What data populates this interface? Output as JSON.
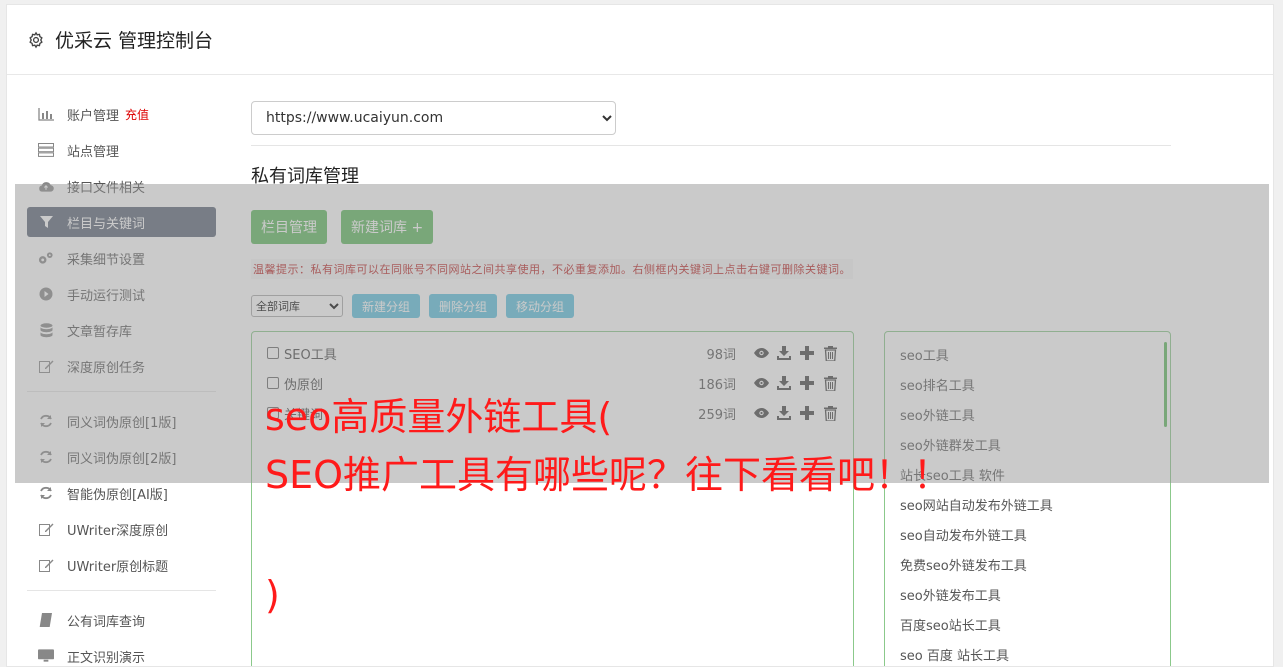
{
  "header": {
    "title": "优采云 管理控制台",
    "icon": "gear-icon"
  },
  "sidebar": {
    "group1": [
      {
        "label": "账户管理",
        "badge": "充值",
        "icon": "bar-chart-icon"
      },
      {
        "label": "站点管理",
        "icon": "server-icon"
      },
      {
        "label": "接口文件相关",
        "icon": "cloud-upload-icon"
      },
      {
        "label": "栏目与关键词",
        "icon": "filter-icon",
        "active": true
      },
      {
        "label": "采集细节设置",
        "icon": "cogs-icon"
      },
      {
        "label": "手动运行测试",
        "icon": "play-circle-icon"
      },
      {
        "label": "文章暂存库",
        "icon": "database-icon"
      },
      {
        "label": "深度原创任务",
        "icon": "edit-icon"
      }
    ],
    "group2": [
      {
        "label": "同义词伪原创[1版]",
        "icon": "refresh-icon"
      },
      {
        "label": "同义词伪原创[2版]",
        "icon": "refresh-icon"
      },
      {
        "label": "智能伪原创[AI版]",
        "icon": "refresh-icon"
      },
      {
        "label": "UWriter深度原创",
        "icon": "edit-icon"
      },
      {
        "label": "UWriter原创标题",
        "icon": "edit-icon"
      }
    ],
    "group3": [
      {
        "label": "公有词库查询",
        "icon": "book-icon"
      },
      {
        "label": "正文识别演示",
        "icon": "monitor-icon"
      }
    ]
  },
  "main": {
    "site_select": {
      "value": "https://www.ucaiyun.com"
    },
    "section_title": "私有词库管理",
    "buttons": {
      "category_manage": "栏目管理",
      "new_library": "新建词库 +"
    },
    "tip": "温馨提示：私有词库可以在同账号不同网站之间共享使用，不必重复添加。右侧框内关键词上点击右键可删除关键词。",
    "group_select": {
      "value": "全部词库"
    },
    "group_buttons": {
      "new_group": "新建分组",
      "delete_group": "删除分组",
      "move_group": "移动分组"
    },
    "libraries": [
      {
        "name": "SEO工具",
        "count": "98词"
      },
      {
        "name": "伪原创",
        "count": "186词"
      },
      {
        "name": "关键词",
        "count": "259词"
      }
    ],
    "keywords": [
      "seo工具",
      "seo排名工具",
      "seo外链工具",
      "seo外链群发工具",
      "站长seo工具 软件",
      "seo网站自动发布外链工具",
      "seo自动发布外链工具",
      "免费seo外链发布工具",
      "seo外链发布工具",
      "百度seo站长工具",
      "seo 百度 站长工具"
    ]
  },
  "overlay": {
    "line1": "seo高质量外链工具(",
    "line2": "SEO推广工具有哪些呢？往下看看吧！！",
    "line3": ")"
  },
  "colors": {
    "active_nav": "#5a6577",
    "green": "#5cb85c",
    "blue": "#5bc0de",
    "overlay_text": "#ff1a1a"
  }
}
